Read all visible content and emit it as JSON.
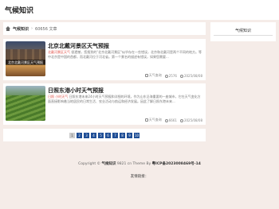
{
  "site": {
    "title": "气候知识"
  },
  "breadcrumb": {
    "home": "气候知识",
    "separator": "›",
    "current": "60656 文章"
  },
  "posts": [
    {
      "title": "北京北戴河景区天气预报",
      "thumb_caption": "北京北戴河景区天气预报",
      "tag1": "北戴河景区天气",
      "excerpt": "很遗憾，您搜到的\"北京北戴河景区\"似乎存在一些错误，北京和北戴河是两个不同的地方。等中北京是中国的首都，而北戴河位于河北省。第一个景名的描述有错误，如果您需要...",
      "views": "2576",
      "date": "2025/08/08",
      "label_views": "天气查询"
    },
    {
      "title": "日照东港小时天气预报",
      "thumb_caption": "",
      "tag1": "日照",
      "tag2": "小时天气",
      "excerpt": "日照东港未来24小时天气预报和详细的环境，作为山东沿海重要的一座城市，它在天气变化方面直接影响着当地居民的日常生活、农业活动与航运和经济发展。因此了解日照东港未来...",
      "views": "6661",
      "date": "2025/08/08",
      "label_views": "天气查询"
    }
  ],
  "pagination": [
    "1",
    "2",
    "3",
    "4",
    "5",
    "6",
    "7",
    "8",
    "9",
    "10"
  ],
  "sidebar": {
    "title": "气候知识"
  },
  "footer": {
    "copyright_prefix": "Copyright ©",
    "site_link": "气候知识",
    "middle": "9821 cn Theme By",
    "icp": "粤ICP备2023008469号-14",
    "friend_links": "友情链接："
  }
}
